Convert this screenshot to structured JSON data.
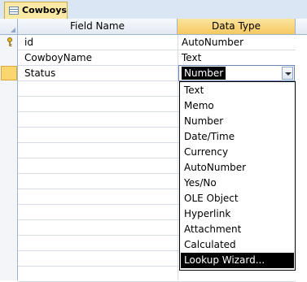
{
  "tab": {
    "label": "Cowboys",
    "icon": "table-icon"
  },
  "columns": {
    "field_name": "Field Name",
    "data_type": "Data Type"
  },
  "rows": [
    {
      "field_name": "id",
      "data_type": "AutoNumber",
      "primary_key": true
    },
    {
      "field_name": "CowboyName",
      "data_type": "Text"
    },
    {
      "field_name": "Status",
      "data_type": "Number",
      "active": true
    }
  ],
  "dropdown": {
    "selected": "Number",
    "options": [
      "Text",
      "Memo",
      "Number",
      "Date/Time",
      "Currency",
      "AutoNumber",
      "Yes/No",
      "OLE Object",
      "Hyperlink",
      "Attachment",
      "Calculated",
      "Lookup Wizard..."
    ],
    "highlighted": "Lookup Wizard..."
  },
  "colors": {
    "active_row": "#fbd66f",
    "header_selected": "#f6c85f",
    "highlight": "#000000"
  }
}
